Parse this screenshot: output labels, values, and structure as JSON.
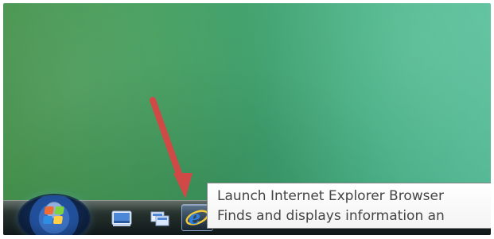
{
  "desktop": {
    "accent_colors": {
      "taskbar_dark": "#11181a",
      "arrow_red": "#cf4a46",
      "tooltip_text": "#444444"
    }
  },
  "taskbar": {
    "start_button_icon": "windows-start-orb-icon",
    "quick_launch": [
      {
        "icon": "show-desktop-icon"
      },
      {
        "icon": "switch-windows-icon"
      },
      {
        "icon": "internet-explorer-icon"
      }
    ]
  },
  "tooltip": {
    "title": "Launch Internet Explorer Browser",
    "description": "Finds and displays information an"
  },
  "annotation": {
    "pointer_icon": "red-arrow-icon"
  }
}
